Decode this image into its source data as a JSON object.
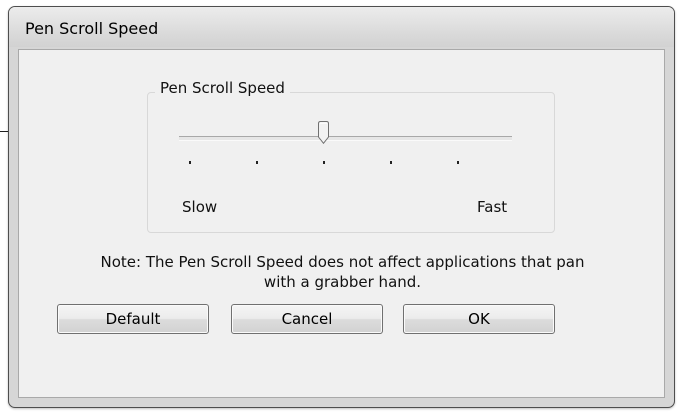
{
  "window": {
    "title": "Pen Scroll Speed"
  },
  "group": {
    "label": "Pen Scroll Speed",
    "slider": {
      "min_label": "Slow",
      "max_label": "Fast",
      "tick_count": 5,
      "level": 0.5
    }
  },
  "note": {
    "line1": "Note: The Pen Scroll Speed does not affect applications that pan",
    "line2": "with a grabber hand."
  },
  "buttons": {
    "default": "Default",
    "cancel": "Cancel",
    "ok": "OK"
  }
}
